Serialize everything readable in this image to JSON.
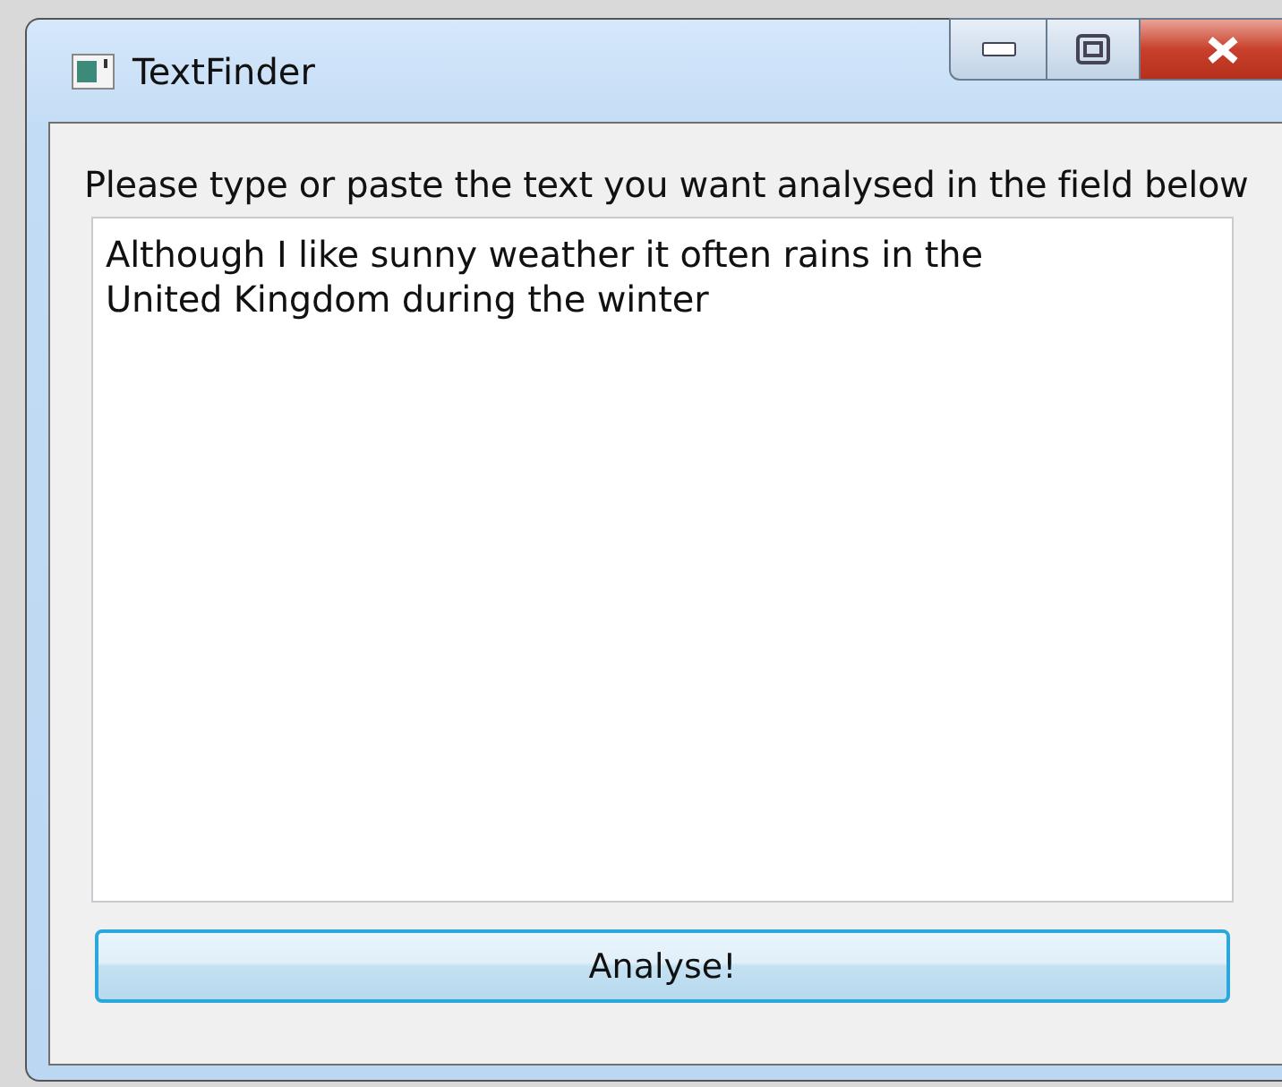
{
  "window": {
    "title": "TextFinder"
  },
  "prompt": "Please type or paste the text you want analysed in the field below",
  "text_field": {
    "value": "Although I like sunny weather it often rains in the United Kingdom during the winter"
  },
  "button": {
    "label": "Analyse!"
  }
}
